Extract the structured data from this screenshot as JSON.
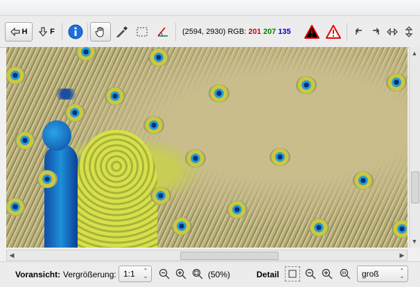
{
  "toolbar": {
    "back_label": "H",
    "forward_label": "F",
    "coords": "(2594, 2930)",
    "rgb_label": "RGB:",
    "rgb_r": "201",
    "rgb_g": "207",
    "rgb_b": "135",
    "icons": [
      "arrow-left-icon",
      "arrow-down-icon",
      "info-icon",
      "hand-pan-icon",
      "eyedropper-icon",
      "selection-rect-icon",
      "angle-tool-icon",
      "warning-shadow-icon",
      "warning-highlight-icon",
      "rotate-left-icon",
      "rotate-right-icon",
      "flip-horizontal-icon",
      "flip-vertical-icon"
    ]
  },
  "preview": {
    "label": "Voransicht:",
    "zoom_label": "Vergrößerung:",
    "zoom_value": "1:1",
    "zoom_percent": "(50%)"
  },
  "detail": {
    "label": "Detail",
    "size_value": "groß"
  },
  "colors": {
    "warning_red": "#e00000",
    "info_blue": "#1e6fd9",
    "rgb_red": "#d00000",
    "rgb_green": "#008000",
    "rgb_blue": "#0000d0"
  }
}
